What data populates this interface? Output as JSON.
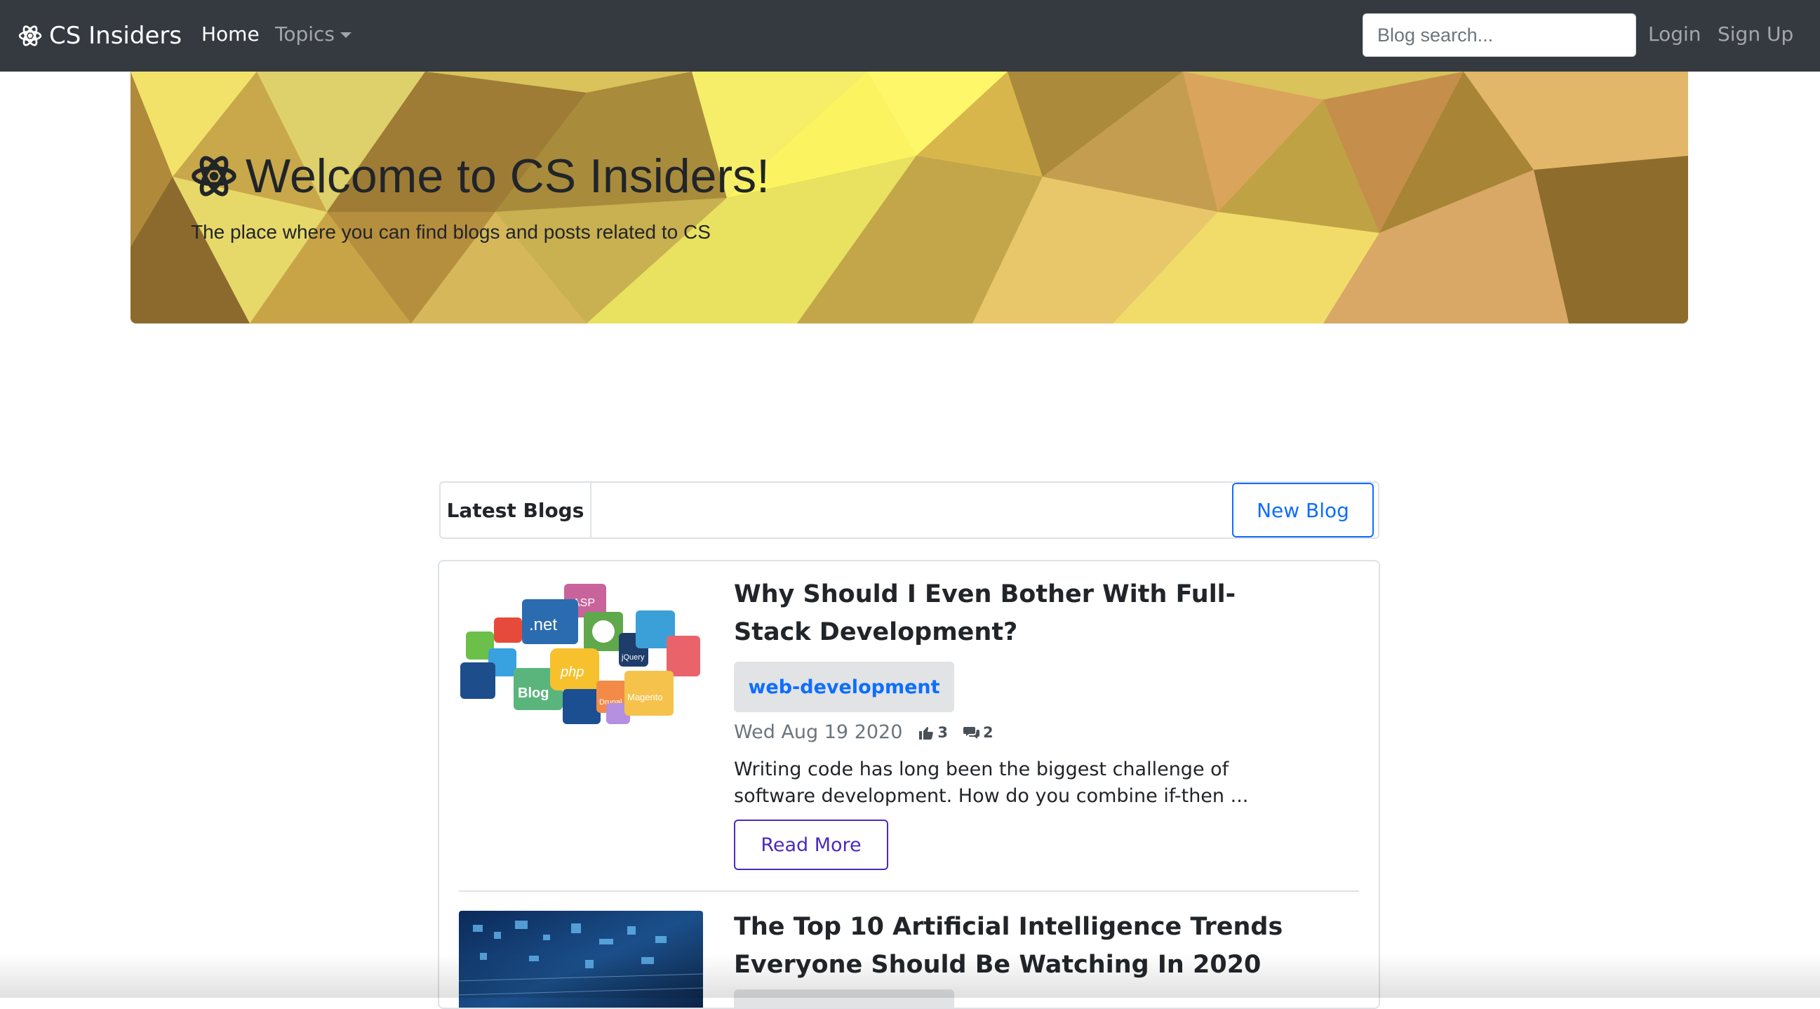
{
  "navbar": {
    "brand": "CS Insiders",
    "brand_icon": "atom-gear-icon",
    "home": "Home",
    "topics": "Topics",
    "search_placeholder": "Blog search...",
    "login": "Login",
    "signup": "Sign Up",
    "bg_color": "#343a40"
  },
  "hero": {
    "title": "Welcome to CS Insiders!",
    "lead": "The place where you can find blogs and posts related to CS"
  },
  "blogs_header": {
    "tab_label": "Latest Blogs",
    "new_blog": "New Blog"
  },
  "posts": [
    {
      "title": "Why Should I Even Bother With Full-Stack Development?",
      "topic": "web-development",
      "date": "Wed Aug 19 2020",
      "likes": "3",
      "comments": "2",
      "excerpt": "Writing code has long been the biggest challenge of software development. How do you combine if-then ...",
      "read_more": "Read More",
      "thumb_labels": [
        "ASP",
        ".net",
        "php",
        "Blog",
        "jQuery",
        "Magento",
        "Drupal"
      ]
    },
    {
      "title": "The Top 10 Artificial Intelligence Trends Everyone Should Be Watching In 2020"
    }
  ],
  "colors": {
    "accent": "#0d6efd",
    "read_more": "#4b2bbd",
    "badge_bg": "#e2e3e5"
  }
}
